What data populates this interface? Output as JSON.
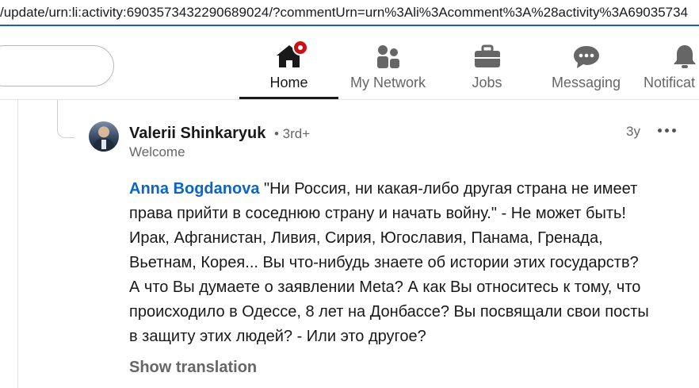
{
  "browser": {
    "url": "/update/urn:li:activity:6903573432290689024/?commentUrn=urn%3Ali%3Acomment%3A%28activity%3A69035734"
  },
  "nav": {
    "items": [
      {
        "label": "Home",
        "icon": "home-icon",
        "active": true,
        "has_notification": true
      },
      {
        "label": "My Network",
        "icon": "network-icon",
        "active": false
      },
      {
        "label": "Jobs",
        "icon": "briefcase-icon",
        "active": false
      },
      {
        "label": "Messaging",
        "icon": "messaging-icon",
        "active": false
      },
      {
        "label": "Notificat",
        "icon": "bell-icon",
        "active": false
      }
    ]
  },
  "comment": {
    "author": "Valerii Shinkaryuk",
    "degree": "• 3rd+",
    "headline": "Welcome",
    "time": "3y",
    "mention": "Anna Bogdanova",
    "lines": [
      " \"Ни Россия, ни какая-либо другая страна не имеет",
      "права прийти в соседнюю страну и начать войну.\" - Не может быть!",
      "Ирак, Афганистан, Ливия, Сирия, Югославия, Панама, Гренада,",
      "Вьетнам, Корея... Вы что-нибудь знаете об истории этих государств?",
      "А что Вы думаете о заявлении Meta? А как Вы относитесь к тому, что",
      "происходило в Одессе, 8 лет на Донбассе? Вы посвящали свои посты",
      "в защиту этих людей? - Или это другое?"
    ],
    "show_translation": "Show translation"
  },
  "colors": {
    "mention": "#0a66c2",
    "active_nav": "#191919",
    "muted": "#666666",
    "notification": "#cc1016",
    "url_underline": "#1f5fbf"
  }
}
